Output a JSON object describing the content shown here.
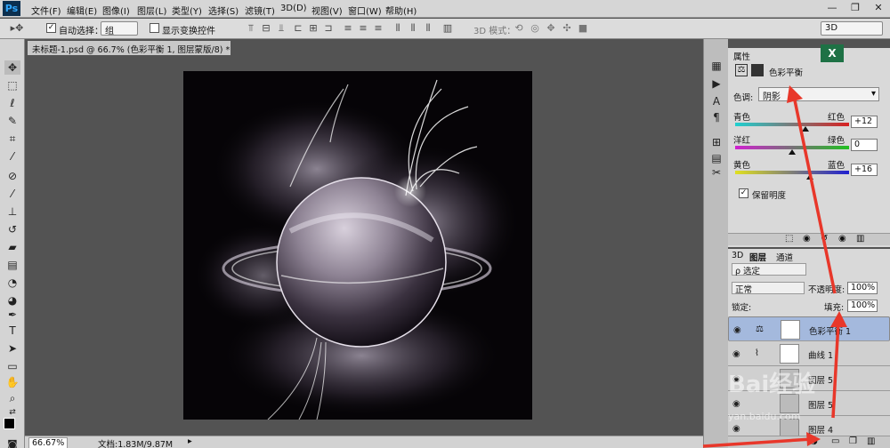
{
  "app": {
    "logo": "Ps"
  },
  "menu": {
    "items": [
      "文件(F)",
      "编辑(E)",
      "图像(I)",
      "图层(L)",
      "类型(Y)",
      "选择(S)",
      "滤镜(T)",
      "3D(D)",
      "视图(V)",
      "窗口(W)",
      "帮助(H)"
    ],
    "window_controls": [
      "—",
      "❐",
      "✕"
    ]
  },
  "options": {
    "auto_select_label": "自动选择：",
    "auto_select_value": "组",
    "show_transform_label": "显示变换控件",
    "mode_3d_label": "3D 模式：",
    "workspace": "3D"
  },
  "document": {
    "tab_title": "未标题-1.psd @ 66.7% (色彩平衡 1, 图层蒙版/8) *",
    "zoom": "66.67%",
    "doc_size": "文档:1.83M/9.87M"
  },
  "properties": {
    "tab_label": "属性",
    "title": "色彩平衡",
    "tone_label": "色调:",
    "tone_value": "阴影",
    "sliders": [
      {
        "left": "青色",
        "right": "红色",
        "value": "+12",
        "position": 0.62,
        "colors": [
          "#1fd0d0",
          "#d82020"
        ]
      },
      {
        "left": "洋红",
        "right": "绿色",
        "value": "0",
        "position": 0.5,
        "colors": [
          "#d020d0",
          "#20c020"
        ]
      },
      {
        "left": "黄色",
        "right": "蓝色",
        "value": "+16",
        "position": 0.66,
        "colors": [
          "#e0e020",
          "#2020d0"
        ]
      }
    ],
    "preserve_luminosity_label": "保留明度",
    "preserve_luminosity_checked": true
  },
  "layers": {
    "tabs": [
      "3D",
      "图层",
      "通道"
    ],
    "filter_label": "ρ 选定",
    "blend_mode": "正常",
    "opacity_label": "不透明度:",
    "opacity_value": "100%",
    "lock_label": "锁定:",
    "fill_label": "填充:",
    "fill_value": "100%",
    "items": [
      {
        "name": "色彩平衡 1",
        "icon": "balance-icon",
        "selected": true
      },
      {
        "name": "曲线 1",
        "icon": "curves-icon",
        "selected": false
      },
      {
        "name": "图层 5",
        "icon": "",
        "selected": false
      },
      {
        "name": "图层 5",
        "icon": "",
        "selected": false
      },
      {
        "name": "图层 4",
        "icon": "",
        "selected": false
      }
    ]
  },
  "watermark": {
    "text": "Bai经验",
    "url": "yan.baidu.com"
  },
  "colors": {
    "accent_arrow": "#e8372a",
    "selected_layer": "#a4b9dd",
    "canvas_bg": "#060407"
  }
}
